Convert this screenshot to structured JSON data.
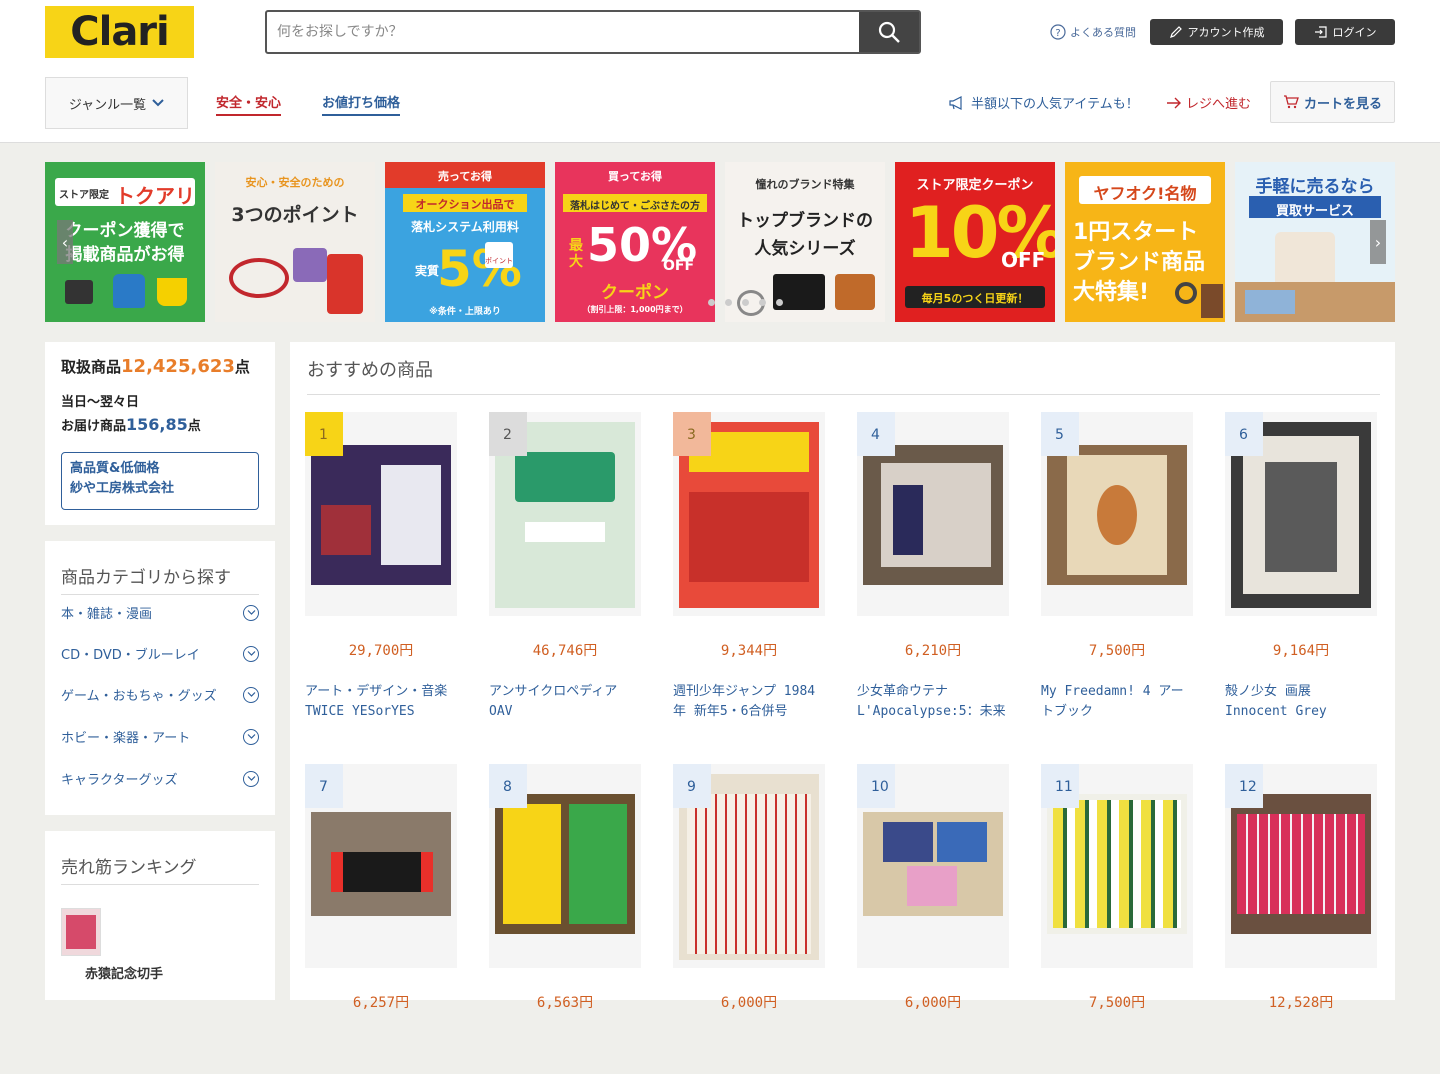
{
  "logo": "Clari",
  "search": {
    "placeholder": "何をお探しですか？"
  },
  "header": {
    "faq": "よくある質問",
    "create_account": "アカウント作成",
    "login": "ログイン"
  },
  "nav": {
    "genre": "ジャンル一覧",
    "safe": "安全・安心",
    "deal": "お値打ち価格",
    "promo": "半額以下の人気アイテムも！",
    "checkout": "レジへ進む",
    "cart": "カートを見る"
  },
  "banners": [
    {
      "lines": [
        "ストア限定",
        "トクアリ",
        "クーポン獲得で",
        "掲載商品がお得"
      ]
    },
    {
      "lines": [
        "安心・安全のための",
        "3つのポイント"
      ]
    },
    {
      "lines": [
        "売ってお得",
        "オークション出品で",
        "落札システム利用料",
        "実質",
        "5%",
        "ポイント",
        "※条件・上限あり"
      ]
    },
    {
      "lines": [
        "買ってお得",
        "落札はじめて・ごぶさたの方",
        "最大",
        "50%",
        "OFF",
        "クーポン",
        "（割引上限：1,000円まで）"
      ]
    },
    {
      "lines": [
        "憧れのブランド特集",
        "トップブランドの",
        "人気シリーズ"
      ]
    },
    {
      "lines": [
        "ストア限定クーポン",
        "10%",
        "OFF",
        "毎月5のつく日更新！"
      ]
    },
    {
      "lines": [
        "ヤフオク!名物",
        "1円スタート",
        "ブランド商品",
        "大特集!"
      ]
    },
    {
      "lines": [
        "手軽に売るなら",
        "買取サービス"
      ]
    }
  ],
  "stats": {
    "count_label": "取扱商品",
    "count": "12,425,623",
    "count_unit": "点",
    "delivery_line1": "当日〜翌々日",
    "delivery_label": "お届け商品",
    "delivery_count": "156,85",
    "delivery_unit": "点",
    "company_line1": "高品質&低価格",
    "company_line2": "紗や工房株式会社"
  },
  "categories": {
    "title": "商品カテゴリから探す",
    "items": [
      "本・雑誌・漫画",
      "CD・DVD・ブルーレイ",
      "ゲーム・おもちゃ・グッズ",
      "ホビー・楽器・アート",
      "キャラクターグッズ"
    ]
  },
  "ranking": {
    "title": "売れ筋ランキング",
    "items": [
      {
        "name": "赤猿記念切手"
      }
    ]
  },
  "recommended": {
    "title": "おすすめの商品",
    "items": [
      {
        "rank": "1",
        "price": "29,700円",
        "name": "アート・デザイン・音楽 TWICE YESorYES TWICE"
      },
      {
        "rank": "2",
        "price": "46,746円",
        "name": "アンサイクロペディア OAV"
      },
      {
        "rank": "3",
        "price": "9,344円",
        "name": "週刊少年ジャンプ 1984年 新年5・6合併号"
      },
      {
        "rank": "4",
        "price": "6,210円",
        "name": "少女革命ウテナ L'Apocalypse:5：未来"
      },
      {
        "rank": "5",
        "price": "7,500円",
        "name": "My Freedamn! 4 アートブック"
      },
      {
        "rank": "6",
        "price": "9,164円",
        "name": "殻ノ少女 画展 Innocent Grey"
      },
      {
        "rank": "7",
        "price": "6,257円",
        "name": ""
      },
      {
        "rank": "8",
        "price": "6,563円",
        "name": ""
      },
      {
        "rank": "9",
        "price": "6,000円",
        "name": ""
      },
      {
        "rank": "10",
        "price": "6,000円",
        "name": ""
      },
      {
        "rank": "11",
        "price": "7,500円",
        "name": ""
      },
      {
        "rank": "12",
        "price": "12,528円",
        "name": ""
      }
    ]
  },
  "colors": {
    "brand": "#f7d417",
    "accent_red": "#c1272d",
    "link_blue": "#2f5f9a",
    "price_orange": "#d05f22"
  }
}
